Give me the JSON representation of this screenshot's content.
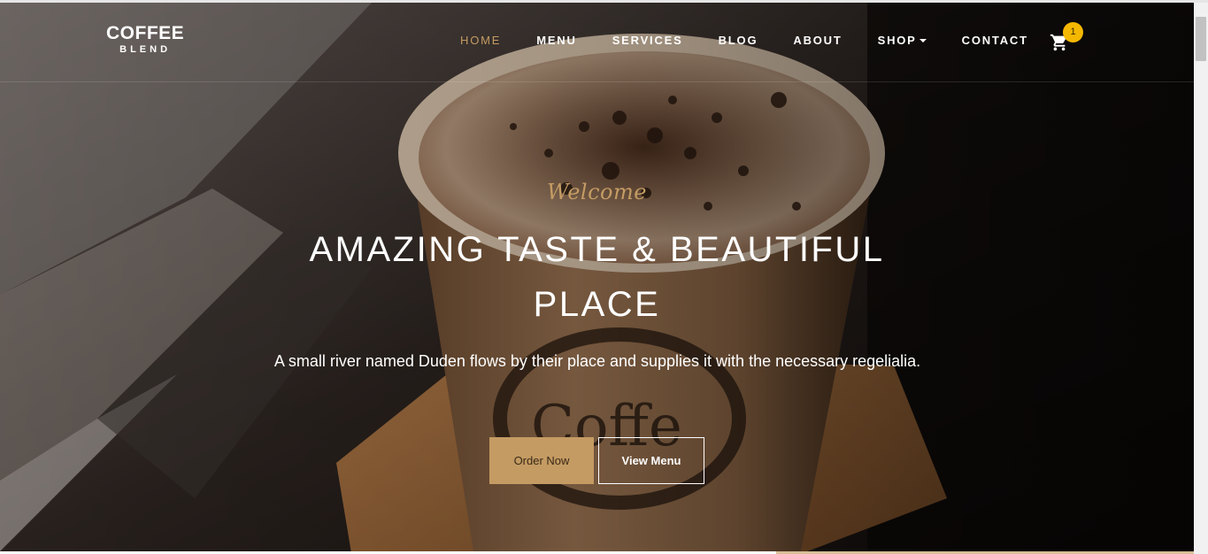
{
  "brand": {
    "main": "COFFEE",
    "sub": "BLEND"
  },
  "nav": {
    "items": [
      {
        "label": "HOME",
        "active": true
      },
      {
        "label": "MENU"
      },
      {
        "label": "SERVICES"
      },
      {
        "label": "BLOG"
      },
      {
        "label": "ABOUT"
      },
      {
        "label": "SHOP"
      },
      {
        "label": "CONTACT"
      }
    ],
    "cart_icon": "cart-icon",
    "cart_count": "1",
    "shop_dropdown_icon": "caret-down-icon"
  },
  "hero": {
    "welcome": "Welcome",
    "headline_line1": "AMAZING TASTE & BEAUTIFUL",
    "headline_line2": "PLACE",
    "subtext": "A small river named Duden flows by their place and supplies it with the necessary regelialia.",
    "buttons": {
      "order": "Order Now",
      "menu": "View Menu"
    },
    "image": "coffee-cup-photo"
  },
  "colors": {
    "accent": "#c49b63",
    "badge": "#f5b800",
    "text": "#ffffff"
  }
}
